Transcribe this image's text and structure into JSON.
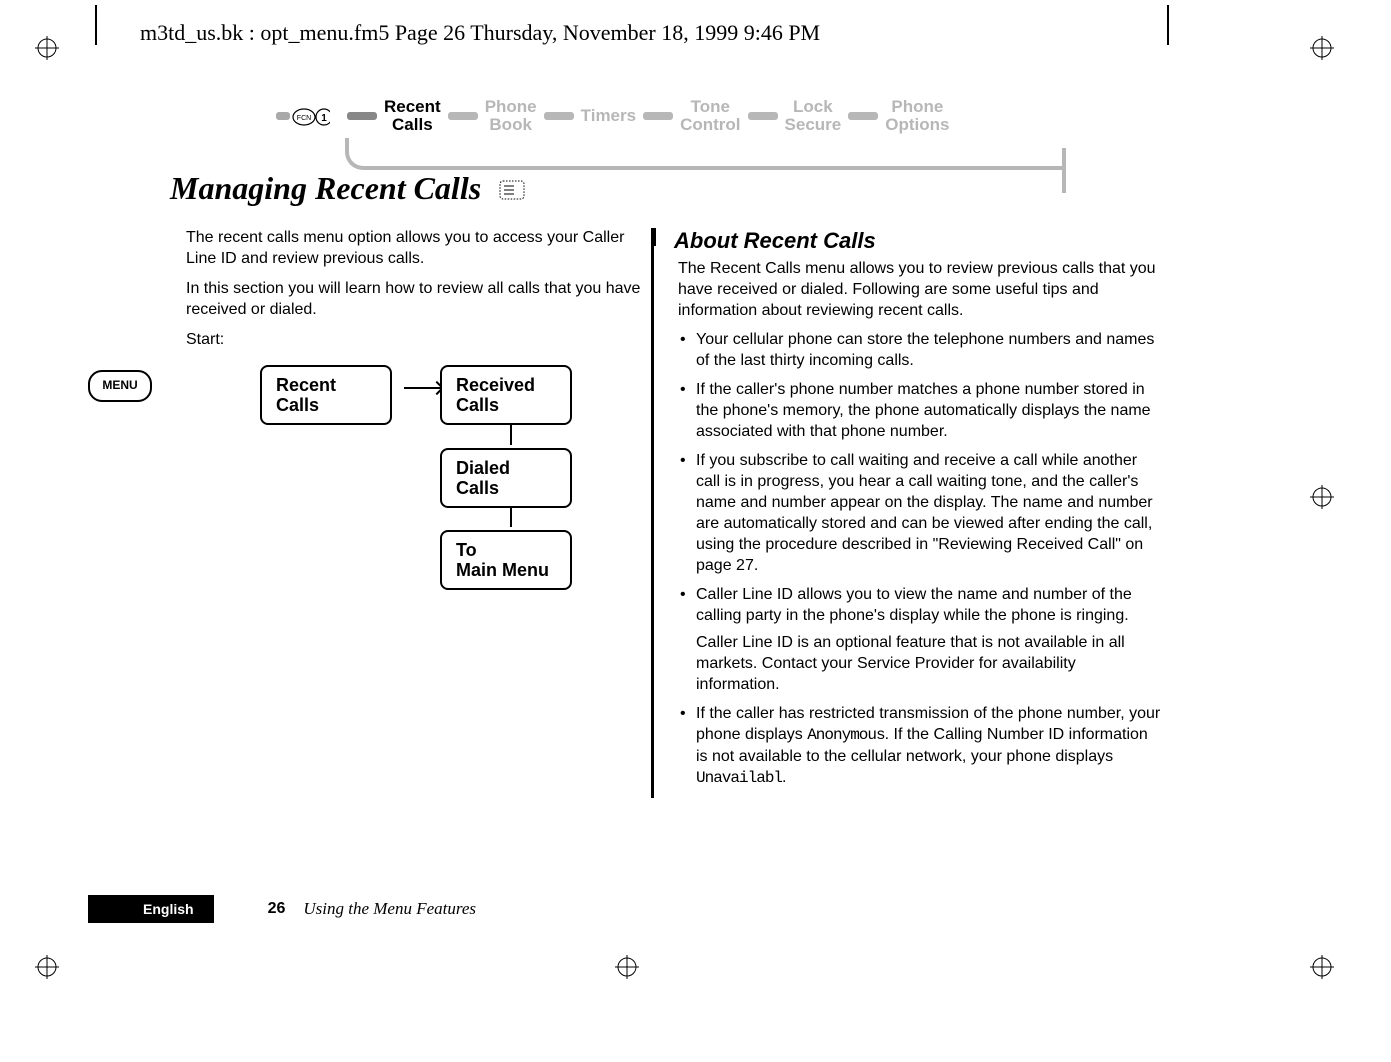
{
  "header_filename": "m3td_us.bk : opt_menu.fm5  Page 26  Thursday, November 18, 1999  9:46 PM",
  "nav": {
    "items": [
      "Recent Calls",
      "Phone Book",
      "Timers",
      "Tone Control",
      "Lock Secure",
      "Phone Options"
    ],
    "active_index": 0
  },
  "heading": "Managing Recent Calls",
  "intro_paragraphs": [
    "The recent calls menu option allows you to access your Caller Line ID and review previous calls.",
    "In this section you will learn how to review all calls that you have received or dialed.",
    "Start:"
  ],
  "menu_key_label": "MENU",
  "diagram": {
    "root": "Recent Calls",
    "children": [
      "Received Calls",
      "Dialed Calls",
      "To Main Menu"
    ]
  },
  "right": {
    "heading": "About Recent Calls",
    "lead": "The Recent Calls menu allows you to review previous calls that you have received or dialed. Following are some useful tips and information about reviewing recent calls.",
    "bullets": [
      {
        "text": "Your cellular phone can store the telephone numbers and names of the last thirty incoming calls."
      },
      {
        "text": "If the caller's phone number matches a phone number stored in the phone's memory, the phone automatically displays the name associated with that phone number."
      },
      {
        "text": "If you subscribe to call waiting and receive a call while another call is in progress, you hear a call waiting tone, and the caller's name and number appear on the display. The name and number are automatically stored and can be viewed after ending the call, using the procedure described in \"Reviewing Received Call\" on page 27."
      },
      {
        "text": "Caller Line ID allows you to view the name and number of the calling party in the phone's display while the phone is ringing.",
        "extra": "Caller Line ID is an optional feature that is not available in all markets. Contact your Service Provider for availability information."
      },
      {
        "prefix": "If the caller has restricted transmission of the phone number, your phone displays ",
        "lcd1": "Anonymous",
        "middle": ". If the Calling Number ID information is not available to the cellular network, your phone displays ",
        "lcd2": "Unavailabl",
        "suffix": "."
      }
    ]
  },
  "footer": {
    "language": "English",
    "page_number": "26",
    "section_title": "Using the Menu Features"
  }
}
